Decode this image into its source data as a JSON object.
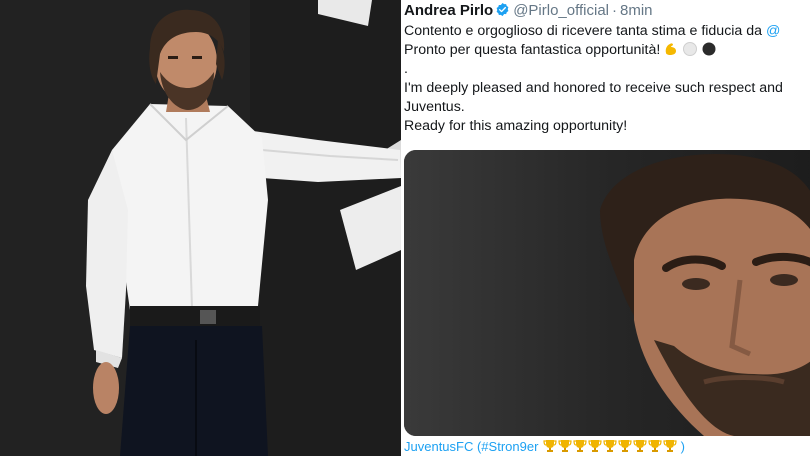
{
  "tweet": {
    "author_name": "Andrea Pirlo",
    "handle": "@Pirlo_official",
    "separator": "·",
    "time": "8min",
    "lines": [
      "Contento e orgoglioso di ricevere tanta stima e fiducia da",
      "Pronto per questa fantastica opportunità!",
      ".",
      "I'm deeply pleased and honored to receive such respect and",
      "Juventus.",
      "Ready for this amazing opportunity!"
    ],
    "mention_fragment": "@",
    "footer_text": "JuventusFC (#Stron9er",
    "footer_suffix": ")",
    "trophy_count": 9
  },
  "icons": {
    "verified": "verified-badge-icon",
    "muscle": "flexed-biceps-emoji",
    "white_circle": "white-circle-emoji",
    "black_circle": "black-circle-emoji",
    "trophy": "trophy-emoji"
  },
  "colors": {
    "link": "#1da1f2",
    "secondary_text": "#657786",
    "primary_text": "#14171a",
    "verified": "#1da1f2"
  }
}
